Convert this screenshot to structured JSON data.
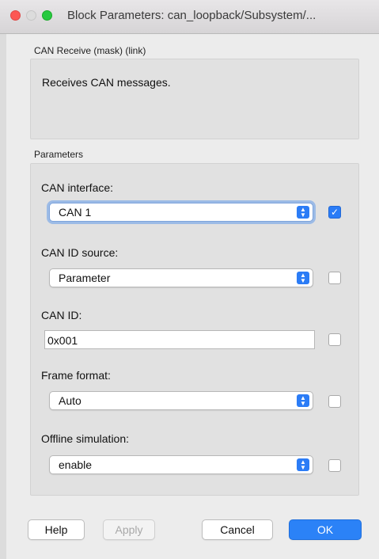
{
  "window": {
    "title": "Block Parameters: can_loopback/Subsystem/..."
  },
  "description": {
    "section_label": "CAN Receive (mask) (link)",
    "text": "Receives CAN messages."
  },
  "parameters": {
    "section_label": "Parameters",
    "can_interface": {
      "label": "CAN interface:",
      "value": "CAN 1",
      "checked": true
    },
    "can_id_source": {
      "label": "CAN ID source:",
      "value": "Parameter",
      "checked": false
    },
    "can_id": {
      "label": "CAN ID:",
      "value": "0x001",
      "checked": false
    },
    "frame_format": {
      "label": "Frame format:",
      "value": "Auto",
      "checked": false
    },
    "offline_simulation": {
      "label": "Offline simulation:",
      "value": "enable",
      "checked": false
    }
  },
  "buttons": {
    "help": "Help",
    "apply": "Apply",
    "cancel": "Cancel",
    "ok": "OK"
  },
  "colors": {
    "accent": "#2b7cf6",
    "close": "#fc5753",
    "zoom": "#27c93f"
  }
}
